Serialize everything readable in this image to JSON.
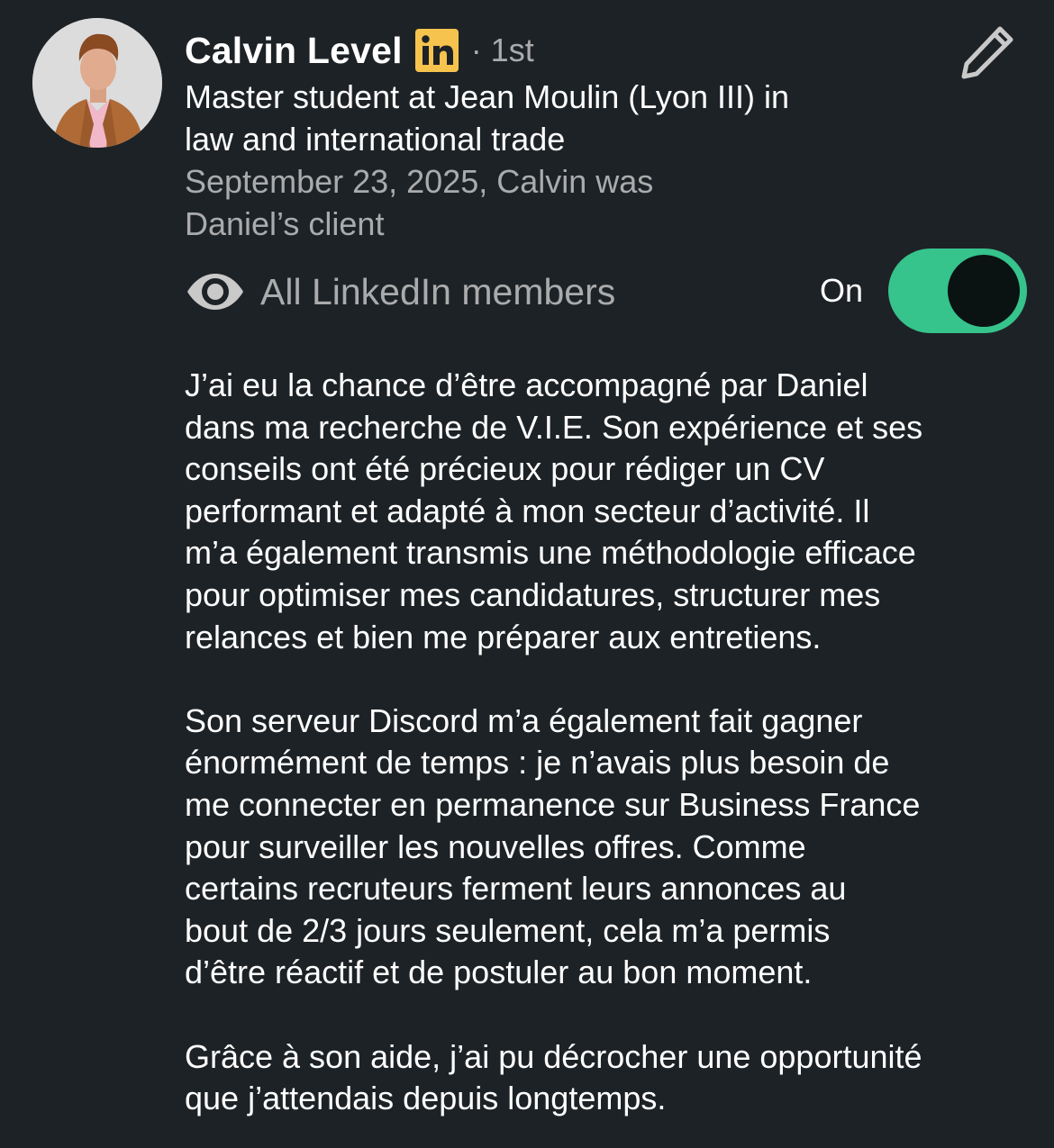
{
  "profile": {
    "name": "Calvin Level",
    "degree": "· 1st",
    "headline": "Master student at Jean Moulin (Lyon III) in\nlaw and international trade",
    "meta": "September 23, 2025, Calvin was\nDaniel’s client",
    "badge_icon": "linkedin-icon",
    "badge_color": "#f5c34e"
  },
  "visibility": {
    "icon": "eye-icon",
    "label": "All LinkedIn members",
    "state_label": "On",
    "enabled": true,
    "toggle_color": "#36c38c"
  },
  "edit_icon": "pencil-icon",
  "recommendation": {
    "paragraphs": [
      "J’ai eu la chance d’être accompagné par Daniel\ndans ma recherche de V.I.E. Son expérience et ses\nconseils ont été précieux pour rédiger un CV\nperformant et adapté à mon secteur d’activité. Il\nm’a également transmis une méthodologie efficace\npour optimiser mes candidatures, structurer mes\nrelances et bien me préparer aux entretiens.",
      "Son serveur Discord m’a également fait gagner\nénormément de temps : je n’avais plus besoin de\nme connecter en permanence sur Business France\npour surveiller les nouvelles offres. Comme\ncertains recruteurs ferment leurs annonces au\nbout de 2/3 jours seulement, cela m’a permis\nd’être réactif et de postuler au bon moment.",
      "Grâce à son aide, j’ai pu décrocher une opportunité\nque j’attendais depuis longtemps."
    ]
  }
}
